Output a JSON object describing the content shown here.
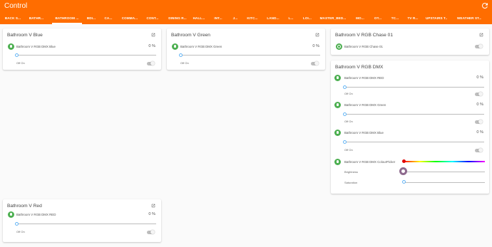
{
  "app": {
    "title": "Control"
  },
  "tabs": [
    {
      "label": "BACK S..."
    },
    {
      "label": "BATHR..."
    },
    {
      "label": "BATHROOM ..."
    },
    {
      "label": "BDI..."
    },
    {
      "label": "CA..."
    },
    {
      "label": "COMMA..."
    },
    {
      "label": "CONT..."
    },
    {
      "label": "DINING R..."
    },
    {
      "label": "HALL..."
    },
    {
      "label": "INT..."
    },
    {
      "label": "J..."
    },
    {
      "label": "KITC..."
    },
    {
      "label": "LAND..."
    },
    {
      "label": "L..."
    },
    {
      "label": "LOI..."
    },
    {
      "label": "MASTER_BED..."
    },
    {
      "label": "MO..."
    },
    {
      "label": "OT..."
    },
    {
      "label": "TC..."
    },
    {
      "label": "TV R..."
    },
    {
      "label": "UPSTAIRS T..."
    },
    {
      "label": "WEATHER ST..."
    }
  ],
  "active_tab_index": 2,
  "cards": {
    "blue": {
      "title": "Bathroom V Blue",
      "device": "Bathroom V RGB DMX Blue",
      "percent": "0 %",
      "level": 0,
      "offon": "Off On"
    },
    "green": {
      "title": "Bathroom V Green",
      "device": "Bathroom V RGB DMX Green",
      "percent": "0 %",
      "level": 0,
      "offon": "Off On"
    },
    "chase": {
      "title": "Bathroom V RGB Chase 01",
      "device": "Bathroom V RGB Chase 01"
    },
    "dmx": {
      "title": "Bathroom V RGB DMX",
      "red": {
        "device": "Bathroom V RGB DMX RED",
        "percent": "0 %",
        "offon": "Off On",
        "level": 0
      },
      "green": {
        "device": "Bathroom V RGB DMX Green",
        "percent": "0 %",
        "offon": "Off On",
        "level": 0
      },
      "blue": {
        "device": "Bathroom V RGB DMX Blue",
        "percent": "0 %",
        "offon": "Off On",
        "level": 0
      },
      "picker": {
        "device": "Bathroom V RGB DMX ColourPicker",
        "brightness_label": "Brightness",
        "saturation_label": "Saturation"
      }
    },
    "red": {
      "title": "Bathroom V Red",
      "device": "Bathroom V RGB DMX RED",
      "percent": "0 %",
      "level": 0,
      "offon": "Off On"
    }
  },
  "colors": {
    "header": "#ff6d00",
    "device_icon": "#4caf50",
    "slider_thumb": "#64b5f6",
    "hue_thumb": "#e00000",
    "brightness_thumb": "#8e6a8e"
  },
  "icons": {
    "refresh": "refresh-icon",
    "open": "open-in-new-icon",
    "device": "bulb-icon"
  }
}
